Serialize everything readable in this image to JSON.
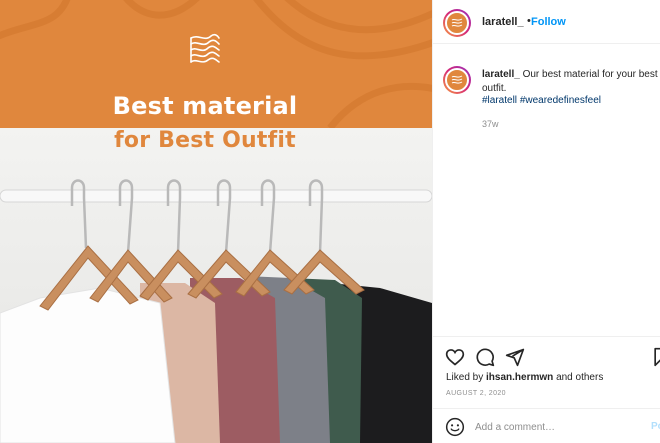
{
  "post": {
    "image": {
      "headline_line1": "Best material",
      "headline_line2": "for Best Outfit",
      "brand_mark_icon": "fingerprint-logo-icon",
      "banner_color": "#e0873d"
    }
  },
  "header": {
    "username": "laratell_",
    "separator": "•",
    "follow_label": "Follow"
  },
  "caption": {
    "username": "laratell_",
    "text": "Our best material for your best outfit.",
    "hashtags": [
      "#laratell",
      "#wearedefinesfeel"
    ],
    "time": "37w"
  },
  "actions": {
    "icons": [
      "heart-icon",
      "comment-icon",
      "share-icon",
      "bookmark-icon"
    ],
    "liked_by_prefix": "Liked by",
    "liked_by_user": "ihsan.hermwn",
    "liked_by_suffix": "and others",
    "date": "AUGUST 2, 2020"
  },
  "comment_box": {
    "placeholder": "Add a comment…",
    "post_label": "Post",
    "emoji_icon": "smiley-icon"
  },
  "colors": {
    "accent_blue": "#0095f6",
    "brand_orange": "#e0873d"
  }
}
